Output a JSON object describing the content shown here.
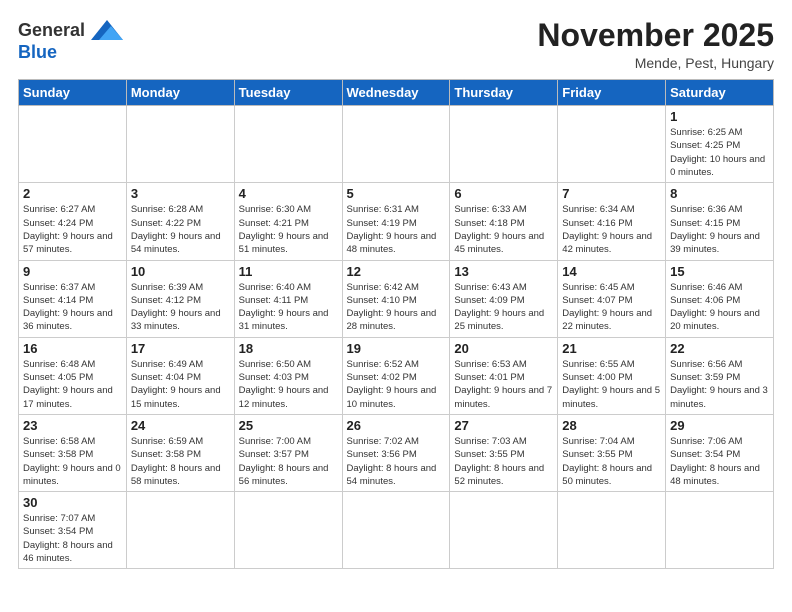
{
  "header": {
    "logo_general": "General",
    "logo_blue": "Blue",
    "month_title": "November 2025",
    "location": "Mende, Pest, Hungary"
  },
  "days_of_week": [
    "Sunday",
    "Monday",
    "Tuesday",
    "Wednesday",
    "Thursday",
    "Friday",
    "Saturday"
  ],
  "weeks": [
    [
      {
        "day": "",
        "info": ""
      },
      {
        "day": "",
        "info": ""
      },
      {
        "day": "",
        "info": ""
      },
      {
        "day": "",
        "info": ""
      },
      {
        "day": "",
        "info": ""
      },
      {
        "day": "",
        "info": ""
      },
      {
        "day": "1",
        "info": "Sunrise: 6:25 AM\nSunset: 4:25 PM\nDaylight: 10 hours and 0 minutes."
      }
    ],
    [
      {
        "day": "2",
        "info": "Sunrise: 6:27 AM\nSunset: 4:24 PM\nDaylight: 9 hours and 57 minutes."
      },
      {
        "day": "3",
        "info": "Sunrise: 6:28 AM\nSunset: 4:22 PM\nDaylight: 9 hours and 54 minutes."
      },
      {
        "day": "4",
        "info": "Sunrise: 6:30 AM\nSunset: 4:21 PM\nDaylight: 9 hours and 51 minutes."
      },
      {
        "day": "5",
        "info": "Sunrise: 6:31 AM\nSunset: 4:19 PM\nDaylight: 9 hours and 48 minutes."
      },
      {
        "day": "6",
        "info": "Sunrise: 6:33 AM\nSunset: 4:18 PM\nDaylight: 9 hours and 45 minutes."
      },
      {
        "day": "7",
        "info": "Sunrise: 6:34 AM\nSunset: 4:16 PM\nDaylight: 9 hours and 42 minutes."
      },
      {
        "day": "8",
        "info": "Sunrise: 6:36 AM\nSunset: 4:15 PM\nDaylight: 9 hours and 39 minutes."
      }
    ],
    [
      {
        "day": "9",
        "info": "Sunrise: 6:37 AM\nSunset: 4:14 PM\nDaylight: 9 hours and 36 minutes."
      },
      {
        "day": "10",
        "info": "Sunrise: 6:39 AM\nSunset: 4:12 PM\nDaylight: 9 hours and 33 minutes."
      },
      {
        "day": "11",
        "info": "Sunrise: 6:40 AM\nSunset: 4:11 PM\nDaylight: 9 hours and 31 minutes."
      },
      {
        "day": "12",
        "info": "Sunrise: 6:42 AM\nSunset: 4:10 PM\nDaylight: 9 hours and 28 minutes."
      },
      {
        "day": "13",
        "info": "Sunrise: 6:43 AM\nSunset: 4:09 PM\nDaylight: 9 hours and 25 minutes."
      },
      {
        "day": "14",
        "info": "Sunrise: 6:45 AM\nSunset: 4:07 PM\nDaylight: 9 hours and 22 minutes."
      },
      {
        "day": "15",
        "info": "Sunrise: 6:46 AM\nSunset: 4:06 PM\nDaylight: 9 hours and 20 minutes."
      }
    ],
    [
      {
        "day": "16",
        "info": "Sunrise: 6:48 AM\nSunset: 4:05 PM\nDaylight: 9 hours and 17 minutes."
      },
      {
        "day": "17",
        "info": "Sunrise: 6:49 AM\nSunset: 4:04 PM\nDaylight: 9 hours and 15 minutes."
      },
      {
        "day": "18",
        "info": "Sunrise: 6:50 AM\nSunset: 4:03 PM\nDaylight: 9 hours and 12 minutes."
      },
      {
        "day": "19",
        "info": "Sunrise: 6:52 AM\nSunset: 4:02 PM\nDaylight: 9 hours and 10 minutes."
      },
      {
        "day": "20",
        "info": "Sunrise: 6:53 AM\nSunset: 4:01 PM\nDaylight: 9 hours and 7 minutes."
      },
      {
        "day": "21",
        "info": "Sunrise: 6:55 AM\nSunset: 4:00 PM\nDaylight: 9 hours and 5 minutes."
      },
      {
        "day": "22",
        "info": "Sunrise: 6:56 AM\nSunset: 3:59 PM\nDaylight: 9 hours and 3 minutes."
      }
    ],
    [
      {
        "day": "23",
        "info": "Sunrise: 6:58 AM\nSunset: 3:58 PM\nDaylight: 9 hours and 0 minutes."
      },
      {
        "day": "24",
        "info": "Sunrise: 6:59 AM\nSunset: 3:58 PM\nDaylight: 8 hours and 58 minutes."
      },
      {
        "day": "25",
        "info": "Sunrise: 7:00 AM\nSunset: 3:57 PM\nDaylight: 8 hours and 56 minutes."
      },
      {
        "day": "26",
        "info": "Sunrise: 7:02 AM\nSunset: 3:56 PM\nDaylight: 8 hours and 54 minutes."
      },
      {
        "day": "27",
        "info": "Sunrise: 7:03 AM\nSunset: 3:55 PM\nDaylight: 8 hours and 52 minutes."
      },
      {
        "day": "28",
        "info": "Sunrise: 7:04 AM\nSunset: 3:55 PM\nDaylight: 8 hours and 50 minutes."
      },
      {
        "day": "29",
        "info": "Sunrise: 7:06 AM\nSunset: 3:54 PM\nDaylight: 8 hours and 48 minutes."
      }
    ],
    [
      {
        "day": "30",
        "info": "Sunrise: 7:07 AM\nSunset: 3:54 PM\nDaylight: 8 hours and 46 minutes."
      },
      {
        "day": "",
        "info": ""
      },
      {
        "day": "",
        "info": ""
      },
      {
        "day": "",
        "info": ""
      },
      {
        "day": "",
        "info": ""
      },
      {
        "day": "",
        "info": ""
      },
      {
        "day": "",
        "info": ""
      }
    ]
  ]
}
